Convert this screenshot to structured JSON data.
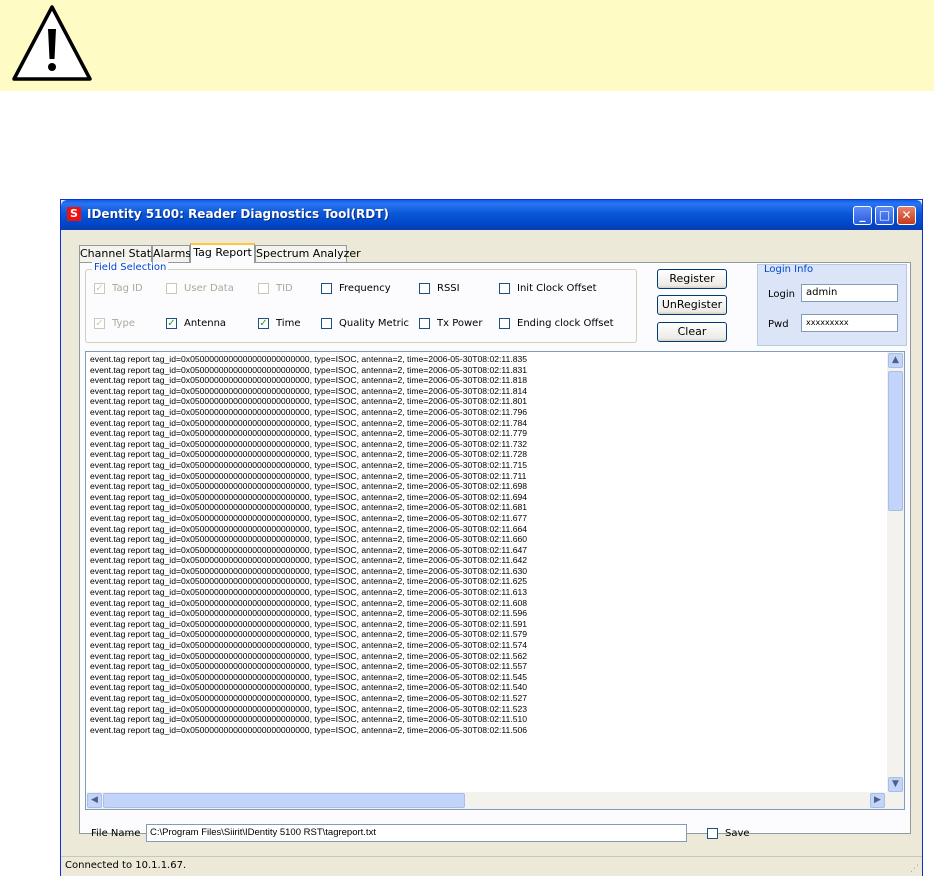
{
  "window": {
    "title": "IDentity 5100: Reader Diagnostics Tool(RDT)",
    "app_icon_letter": "S",
    "controls": {
      "minimize": "_",
      "maximize": "□",
      "close": "✕"
    }
  },
  "tabs": [
    "Channel Stats",
    "Alarms",
    "Tag Report",
    "Spectrum Analyzer"
  ],
  "active_tab": "Tag Report",
  "field_selection": {
    "legend": "Field Selection",
    "fields": [
      {
        "label": "Tag ID",
        "checked": true,
        "enabled": false
      },
      {
        "label": "User Data",
        "checked": false,
        "enabled": false
      },
      {
        "label": "TID",
        "checked": false,
        "enabled": false
      },
      {
        "label": "Frequency",
        "checked": false,
        "enabled": true
      },
      {
        "label": "RSSI",
        "checked": false,
        "enabled": true
      },
      {
        "label": "Init Clock Offset",
        "checked": false,
        "enabled": true
      },
      {
        "label": "Type",
        "checked": true,
        "enabled": false
      },
      {
        "label": "Antenna",
        "checked": true,
        "enabled": true
      },
      {
        "label": "Time",
        "checked": true,
        "enabled": true
      },
      {
        "label": "Quality Metric",
        "checked": false,
        "enabled": true
      },
      {
        "label": "Tx Power",
        "checked": false,
        "enabled": true
      },
      {
        "label": "Ending clock Offset",
        "checked": false,
        "enabled": true
      }
    ]
  },
  "buttons": {
    "register": "Register",
    "unregister": "UnRegister",
    "clear": "Clear"
  },
  "login": {
    "legend": "Login Info",
    "login_label": "Login",
    "login_value": "admin",
    "pwd_label": "Pwd",
    "pwd_value": "xxxxxxxxx"
  },
  "log": {
    "prefix": "event.tag report tag_id=0x0500000000000000000000000, type=ISOC, antenna=2, time=2006-05-30T08:02:11.",
    "millis": [
      "835",
      "831",
      "818",
      "814",
      "801",
      "796",
      "784",
      "779",
      "732",
      "728",
      "715",
      "711",
      "698",
      "694",
      "681",
      "677",
      "664",
      "660",
      "647",
      "642",
      "630",
      "625",
      "613",
      "608",
      "596",
      "591",
      "579",
      "574",
      "562",
      "557",
      "545",
      "540",
      "527",
      "523",
      "510",
      "506"
    ]
  },
  "file": {
    "label": "File Name",
    "path": "C:\\Program Files\\Siirit\\IDentity 5100 RST\\tagreport.txt",
    "save_label": "Save",
    "save_checked": false
  },
  "status": {
    "text": "Connected to 10.1.1.67."
  }
}
